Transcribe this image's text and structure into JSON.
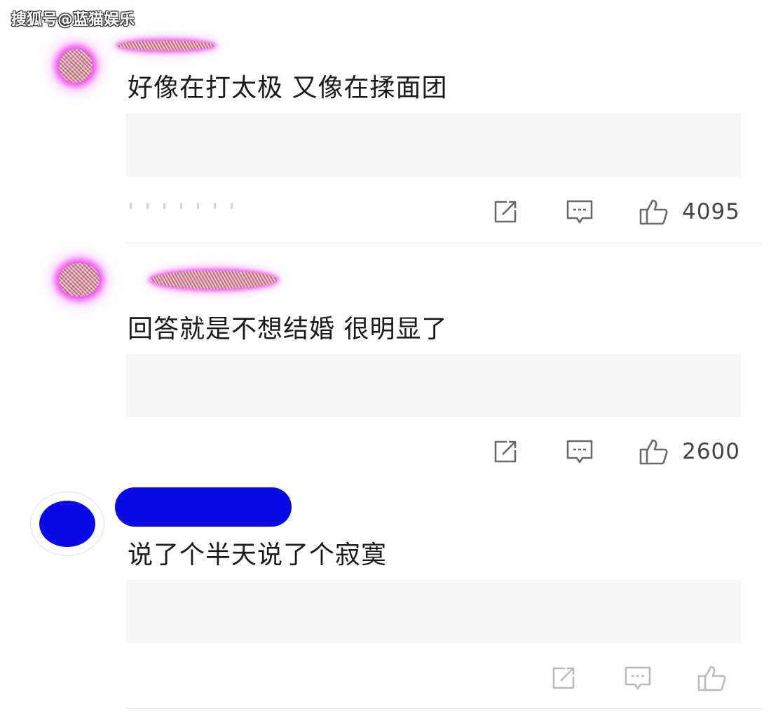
{
  "watermark": "搜狐号@蓝猫娱乐",
  "comments": [
    {
      "text": "好像在打太极 又像在揉面团",
      "likes": "4095"
    },
    {
      "text": "回答就是不想结婚 很明显了",
      "likes": "2600"
    },
    {
      "text": "说了个半天说了个寂寞",
      "likes": ""
    }
  ],
  "icons": {
    "share": "share-icon",
    "reply": "comment-icon",
    "like": "thumbs-up-icon"
  },
  "colors": {
    "censor_glow": "#ee44ee",
    "censor_blue": "#0a0ae6",
    "quote_bg": "#f6f6f6",
    "count_text": "#444444"
  }
}
